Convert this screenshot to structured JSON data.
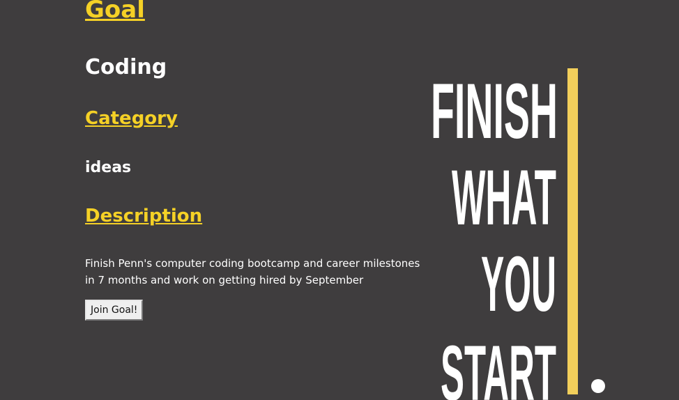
{
  "goal": {
    "heading": "Goal",
    "title": "Coding"
  },
  "category": {
    "heading": "Category",
    "value": "ideas"
  },
  "description": {
    "heading": "Description",
    "text": "Finish Penn's computer coding bootcamp and career milestones in 7 months and work on getting hired by September"
  },
  "join_button": {
    "label": "Join Goal!"
  },
  "poster": {
    "line1": "FINISH",
    "line2": "WHAT",
    "line3": "YOU",
    "line4": "START",
    "accent_color": "#f2cf5b",
    "text_color": "#ffffff"
  },
  "colors": {
    "background": "#3f3d3e",
    "heading": "#f5d126",
    "text": "#ffffff"
  }
}
